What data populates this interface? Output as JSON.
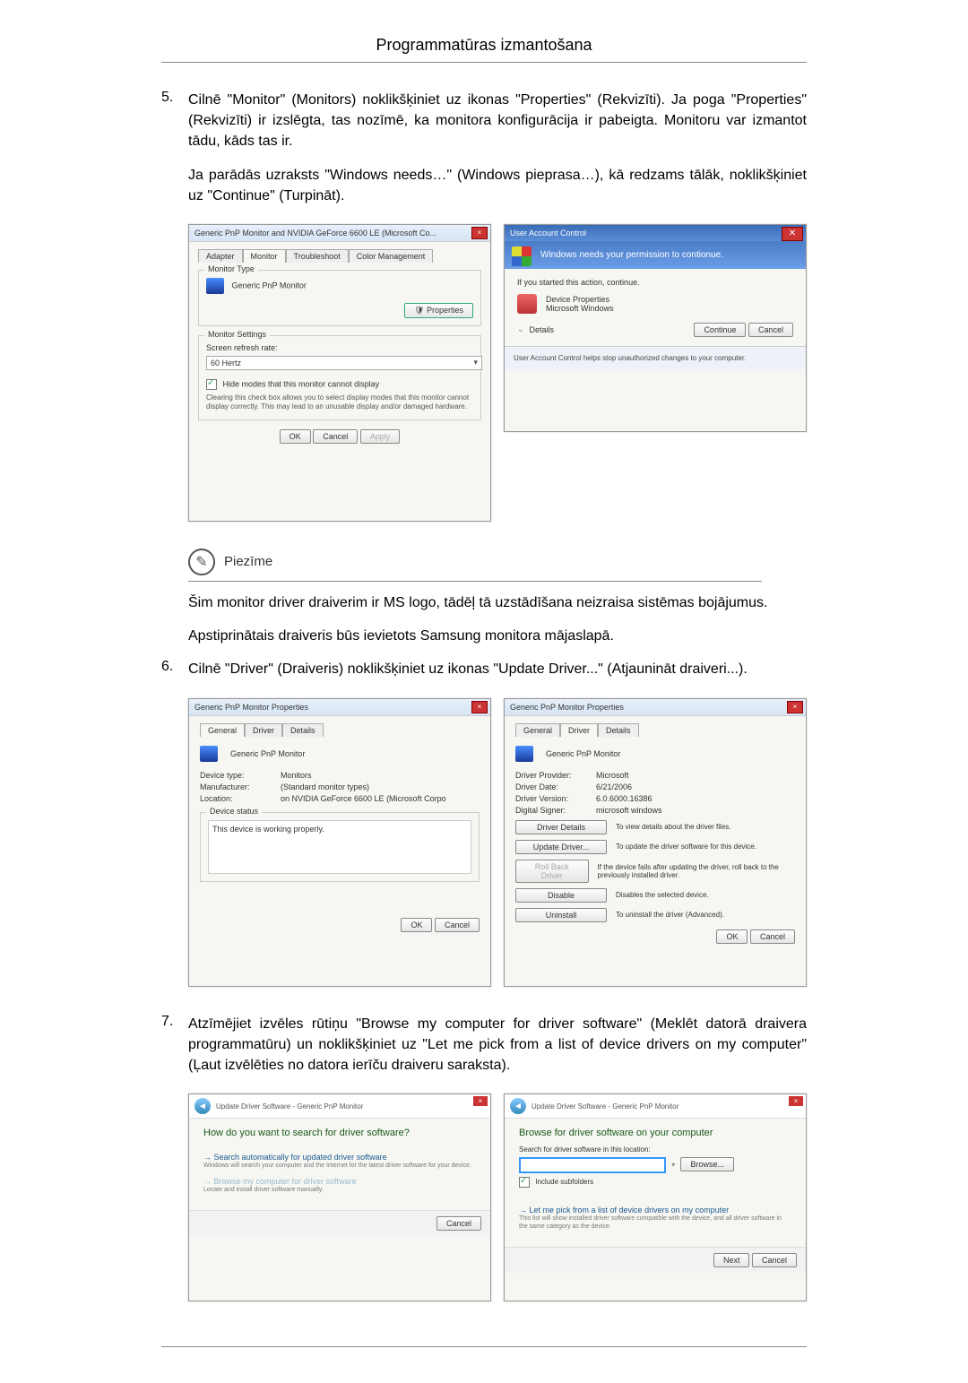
{
  "header": {
    "title": "Programmatūras izmantošana"
  },
  "steps": {
    "s5": {
      "num": "5.",
      "text": "Cilnē \"Monitor\" (Monitors) noklikšķiniet uz ikonas \"Properties\" (Rekvizīti). Ja poga \"Properties\" (Rekvizīti) ir izslēgta, tas nozīmē, ka monitora konfigurācija ir pabeigta. Monitoru var izmantot tādu, kāds tas ir.",
      "para2": "Ja parādās uzraksts \"Windows needs…\" (Windows pieprasa…), kā redzams tālāk, noklikšķiniet uz \"Continue\" (Turpināt)."
    },
    "s6": {
      "num": "6.",
      "text": "Cilnē \"Driver\" (Draiveris) noklikšķiniet uz ikonas \"Update Driver...\" (Atjaunināt draiveri...)."
    },
    "s7": {
      "num": "7.",
      "text": "Atzīmējiet izvēles rūtiņu \"Browse my computer for driver software\" (Meklēt datorā draivera programmatūru) un noklikšķiniet uz \"Let me pick from a list of device drivers on my computer\" (Ļaut izvēlēties no datora ierīču draiveru saraksta)."
    }
  },
  "note": {
    "title": "Piezīme",
    "body1": "Šim monitor driver draiverim ir MS logo, tādēļ tā uzstādīšana neizraisa sistēmas bojājumus.",
    "body2": "Apstiprinātais draiveris būs ievietots Samsung monitora mājaslapā."
  },
  "ss_monitor": {
    "title": "Generic PnP Monitor and NVIDIA GeForce 6600 LE (Microsoft Co...",
    "tabs": {
      "adapter": "Adapter",
      "monitor": "Monitor",
      "troubleshoot": "Troubleshoot",
      "color": "Color Management"
    },
    "group_type": "Monitor Type",
    "monitor_name": "Generic PnP Monitor",
    "properties_btn": "Properties",
    "group_settings": "Monitor Settings",
    "refresh_label": "Screen refresh rate:",
    "refresh_value": "60 Hertz",
    "hide_modes": "Hide modes that this monitor cannot display",
    "hide_help": "Clearing this check box allows you to select display modes that this monitor cannot display correctly. This may lead to an unusable display and/or damaged hardware.",
    "ok": "OK",
    "cancel": "Cancel",
    "apply": "Apply"
  },
  "ss_uac": {
    "title": "User Account Control",
    "banner": "Windows needs your permission to contionue.",
    "line1": "If you started this action, continue.",
    "prog": "Device Properties",
    "pub": "Microsoft Windows",
    "details": "Details",
    "continue": "Continue",
    "cancel": "Cancel",
    "footer": "User Account Control helps stop unauthorized changes to your computer."
  },
  "ss_general": {
    "title": "Generic PnP Monitor Properties",
    "tabs": {
      "general": "General",
      "driver": "Driver",
      "details": "Details"
    },
    "name": "Generic PnP Monitor",
    "devtype_l": "Device type:",
    "devtype_v": "Monitors",
    "manu_l": "Manufacturer:",
    "manu_v": "(Standard monitor types)",
    "loc_l": "Location:",
    "loc_v": "on NVIDIA GeForce 6600 LE (Microsoft Corpo",
    "status_l": "Device status",
    "status_v": "This device is working properly.",
    "ok": "OK",
    "cancel": "Cancel"
  },
  "ss_driver": {
    "title": "Generic PnP Monitor Properties",
    "tabs": {
      "general": "General",
      "driver": "Driver",
      "details": "Details"
    },
    "name": "Generic PnP Monitor",
    "prov_l": "Driver Provider:",
    "prov_v": "Microsoft",
    "date_l": "Driver Date:",
    "date_v": "6/21/2006",
    "ver_l": "Driver Version:",
    "ver_v": "6.0.6000.16386",
    "sign_l": "Digital Signer:",
    "sign_v": "microsoft windows",
    "btn_details": "Driver Details",
    "btn_details_d": "To view details about the driver files.",
    "btn_update": "Update Driver...",
    "btn_update_d": "To update the driver software for this device.",
    "btn_roll": "Roll Back Driver",
    "btn_roll_d": "If the device fails after updating the driver, roll back to the previously installed driver.",
    "btn_disable": "Disable",
    "btn_disable_d": "Disables the selected device.",
    "btn_uninstall": "Uninstall",
    "btn_uninstall_d": "To uninstall the driver (Advanced).",
    "ok": "OK",
    "cancel": "Cancel"
  },
  "ss_wiz1": {
    "crumb": "Update Driver Software - Generic PnP Monitor",
    "heading": "How do you want to search for driver software?",
    "opt1_t": "Search automatically for updated driver software",
    "opt1_s": "Windows will search your computer and the Internet for the latest driver software for your device.",
    "opt2_t": "Browse my computer for driver software",
    "opt2_s": "Locate and install driver software manually.",
    "cancel": "Cancel"
  },
  "ss_wiz2": {
    "crumb": "Update Driver Software - Generic PnP Monitor",
    "heading": "Browse for driver software on your computer",
    "search_l": "Search for driver software in this location:",
    "browse": "Browse...",
    "include": "Include subfolders",
    "opt_t": "Let me pick from a list of device drivers on my computer",
    "opt_s": "This list will show installed driver software compatible with the device, and all driver software in the same category as the device.",
    "next": "Next",
    "cancel": "Cancel"
  }
}
